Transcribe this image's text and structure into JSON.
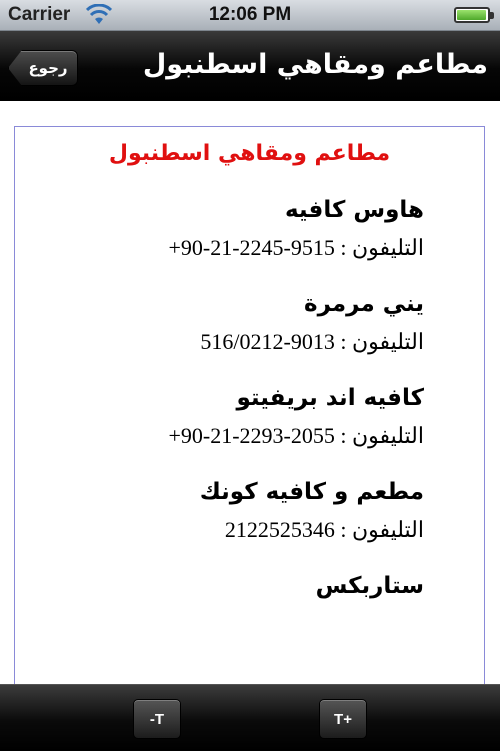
{
  "status_bar": {
    "carrier": "Carrier",
    "time": "12:06 PM"
  },
  "nav": {
    "back_label": "رجوع",
    "title": "مطاعم ومقاهي اسطنبول"
  },
  "content": {
    "heading": "مطاعم ومقاهي اسطنبول",
    "heading_color": "#e01010",
    "entries": [
      {
        "name": "هاوس كافيه",
        "phone_label": "التليفون :",
        "phone": "+90-21-2245-9515"
      },
      {
        "name": "يني مرمرة",
        "phone_label": "التليفون :",
        "phone": "516/0212-9013"
      },
      {
        "name": "كافيه اند بريفيتو",
        "phone_label": "التليفون :",
        "phone": "+90-21-2293-2055"
      },
      {
        "name": "مطعم و كافيه كونك",
        "phone_label": "التليفون :",
        "phone": "2122525346"
      },
      {
        "name": "ستاربكس"
      }
    ]
  },
  "toolbar": {
    "decrease_label": "-T",
    "increase_label": "T+"
  },
  "icons": {
    "wifi": "wifi-icon",
    "battery": "battery-icon",
    "back": "back-arrow-button"
  }
}
